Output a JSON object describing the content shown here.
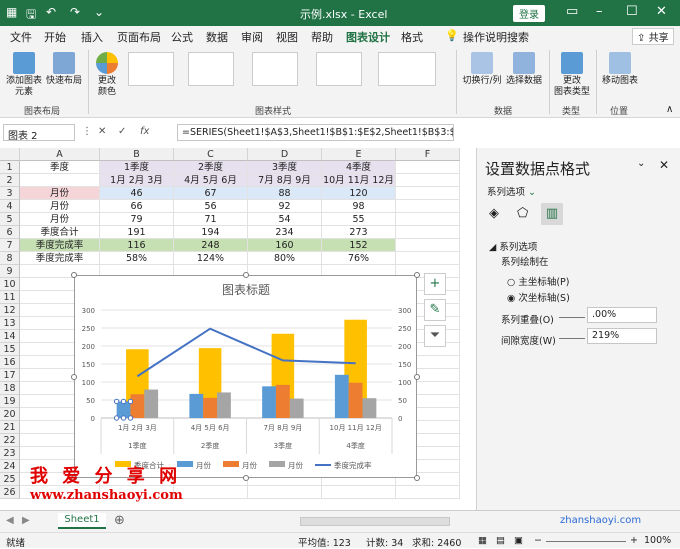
{
  "window": {
    "title": "示例.xlsx - Excel",
    "login": "登录"
  },
  "menu_tabs": [
    "文件",
    "开始",
    "插入",
    "页面布局",
    "公式",
    "数据",
    "审阅",
    "视图",
    "帮助",
    "图表设计",
    "格式"
  ],
  "tell_me": "操作说明搜索",
  "share": "共享",
  "ribbon": {
    "add_element": "添加图表\n元素",
    "quick_layout": "快速布局",
    "change_colors": "更改\n颜色",
    "switch_row_col": "切换行/列",
    "select_data": "选择数据",
    "change_type": "更改\n图表类型",
    "move_chart": "移动图表",
    "groups": {
      "layout": "图表布局",
      "styles": "图表样式",
      "data": "数据",
      "type": "类型",
      "location": "位置"
    }
  },
  "formula_bar": {
    "name_box": "图表 2",
    "formula": "=SERIES(Sheet1!$A$3,Sheet1!$B$1:$E$2,Sheet1!$B$3:$E$3,1)"
  },
  "columns": [
    "A",
    "B",
    "C",
    "D",
    "E",
    "F"
  ],
  "rows": [
    "1",
    "2",
    "3",
    "4",
    "5",
    "6",
    "7",
    "8",
    "9",
    "10",
    "11",
    "12",
    "13",
    "14",
    "15",
    "16",
    "17",
    "18",
    "19",
    "20",
    "21",
    "22",
    "23",
    "24",
    "25",
    "26"
  ],
  "cells": {
    "header": [
      "季度",
      "1季度",
      "2季度",
      "3季度",
      "4季度"
    ],
    "months": [
      "",
      "1月 2月 3月",
      "4月 5月 6月",
      "7月 8月 9月",
      "10月 11月 12月"
    ],
    "r3": [
      "月份",
      "46",
      "67",
      "88",
      "120"
    ],
    "r4": [
      "月份",
      "66",
      "56",
      "92",
      "98"
    ],
    "r5": [
      "月份",
      "79",
      "71",
      "54",
      "55"
    ],
    "r6": [
      "季度合计",
      "191",
      "194",
      "234",
      "273"
    ],
    "r7": [
      "季度完成率",
      "116",
      "248",
      "160",
      "152"
    ],
    "r8": [
      "季度完成率",
      "58%",
      "124%",
      "80%",
      "76%"
    ]
  },
  "sheet_tab": "Sheet1",
  "status": {
    "ready": "就绪",
    "average": "平均值: 123",
    "count": "计数: 34",
    "sum": "求和: 2460",
    "zoom": "100%"
  },
  "pane": {
    "title": "设置数据点格式",
    "options_label": "系列选项",
    "section": "系列选项",
    "plot_on": "系列绘制在",
    "primary_axis": "主坐标轴(P)",
    "secondary_axis": "次坐标轴(S)",
    "overlap_label": "系列重叠(O)",
    "overlap_value": ".00%",
    "gap_label": "间隙宽度(W)",
    "gap_value": "219%"
  },
  "watermark": {
    "cn": "我 爱 分 享 网",
    "url": "www.zhanshaoyi.com",
    "corner": "zhanshaoyi.com"
  },
  "colors": {
    "accent": "#217346",
    "yellow": "#FFC000",
    "blue": "#5B9BD5",
    "orange": "#ED7D31",
    "gray": "#A5A5A5",
    "line": "#4472C4"
  },
  "chart_data": {
    "type": "bar",
    "title": "图表标题",
    "categories": [
      "1月 2月 3月",
      "4月 5月 6月",
      "7月 8月 9月",
      "10月 11月 12月"
    ],
    "group_labels": [
      "1季度",
      "2季度",
      "3季度",
      "4季度"
    ],
    "series": [
      {
        "name": "季度合计",
        "type": "bar",
        "axis": "secondary",
        "values": [
          191,
          194,
          234,
          273
        ],
        "color": "#FFC000"
      },
      {
        "name": "月份",
        "type": "bar",
        "axis": "primary",
        "values": [
          46,
          67,
          88,
          120
        ],
        "color": "#5B9BD5"
      },
      {
        "name": "月份",
        "type": "bar",
        "axis": "primary",
        "values": [
          66,
          56,
          92,
          98
        ],
        "color": "#ED7D31"
      },
      {
        "name": "月份",
        "type": "bar",
        "axis": "primary",
        "values": [
          79,
          71,
          54,
          55
        ],
        "color": "#A5A5A5"
      },
      {
        "name": "季度完成率",
        "type": "line",
        "axis": "secondary",
        "values": [
          116,
          248,
          160,
          152
        ],
        "color": "#4472C4"
      }
    ],
    "ylim": [
      0,
      300
    ],
    "y2lim": [
      0,
      300
    ],
    "yticks": [
      0,
      50,
      100,
      150,
      200,
      250,
      300
    ],
    "legend": "bottom"
  }
}
